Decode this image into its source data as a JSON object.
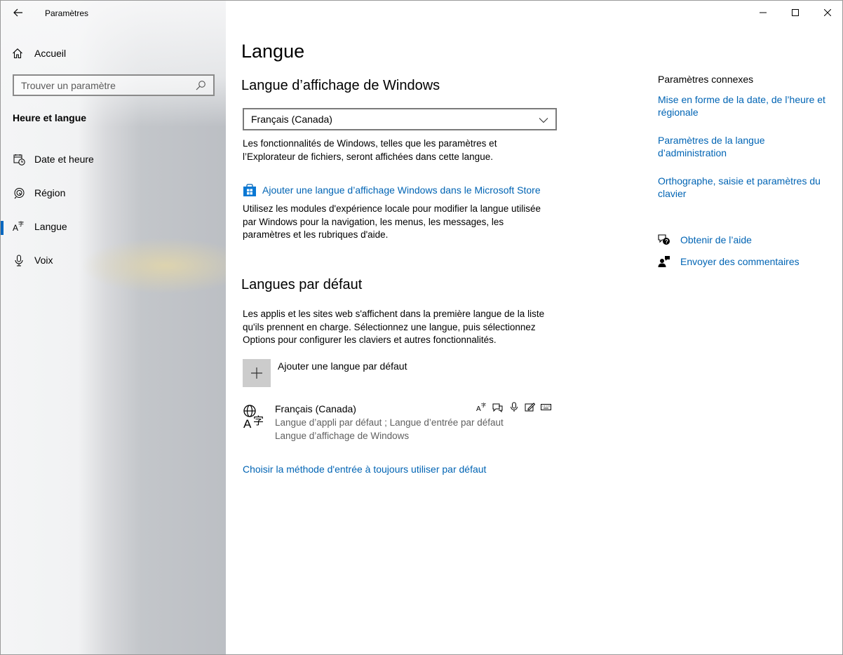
{
  "app": {
    "title": "Paramètres"
  },
  "sidebar": {
    "home_label": "Accueil",
    "search": {
      "placeholder": "Trouver un paramètre",
      "value": ""
    },
    "section_title": "Heure et langue",
    "items": [
      {
        "label": "Date et heure",
        "icon": "calendar-clock-icon",
        "selected": false
      },
      {
        "label": "Région",
        "icon": "globe-region-icon",
        "selected": false
      },
      {
        "label": "Langue",
        "icon": "language-icon",
        "selected": true
      },
      {
        "label": "Voix",
        "icon": "microphone-icon",
        "selected": false
      }
    ]
  },
  "main": {
    "page_title": "Langue",
    "display_language": {
      "heading": "Langue d’affichage de Windows",
      "selected": "Français (Canada)",
      "description_line1": "Les fonctionnalités de Windows, telles que les paramètres et",
      "description_line2": "l’Explorateur de fichiers, seront affichées dans cette langue.",
      "store_link": "Ajouter une langue d’affichage Windows dans le Microsoft Store",
      "lxp_line1": "Utilisez les modules d'expérience locale pour modifier la langue utilisée",
      "lxp_line2": "par Windows pour la navigation, les menus, les messages, les",
      "lxp_line3": "paramètres et les rubriques d'aide."
    },
    "preferred_languages": {
      "heading": "Langues par défaut",
      "description_line1": "Les applis et les sites web s'affichent dans la première langue de la liste",
      "description_line2": "qu'ils prennent en charge. Sélectionnez une langue, puis sélectionnez",
      "description_line3": "Options pour configurer les claviers et autres fonctionnalités.",
      "add_label": "Ajouter une langue par défaut",
      "languages": [
        {
          "name": "Français (Canada)",
          "sub_line1": "Langue d’appli par défaut ; Langue d’entrée par défaut",
          "sub_line2": "Langue d’affichage de Windows",
          "features": [
            "display-language-icon",
            "text-to-speech-icon",
            "speech-icon",
            "handwriting-icon",
            "keyboard-icon"
          ]
        }
      ],
      "choose_input_link": "Choisir la méthode d'entrée à toujours utiliser par défaut"
    }
  },
  "related": {
    "title": "Paramètres connexes",
    "link1_line1": "Mise en forme de la date, de l’heure et",
    "link1_line2": "régionale",
    "link2_line1": "Paramètres de la langue",
    "link2_line2": "d’administration",
    "link3_line1": "Orthographe, saisie et paramètres du",
    "link3_line2": "clavier",
    "help_label": "Obtenir de l’aide",
    "feedback_label": "Envoyer des commentaires"
  },
  "colors": {
    "accent": "#0067c0",
    "link": "#0064b4"
  }
}
